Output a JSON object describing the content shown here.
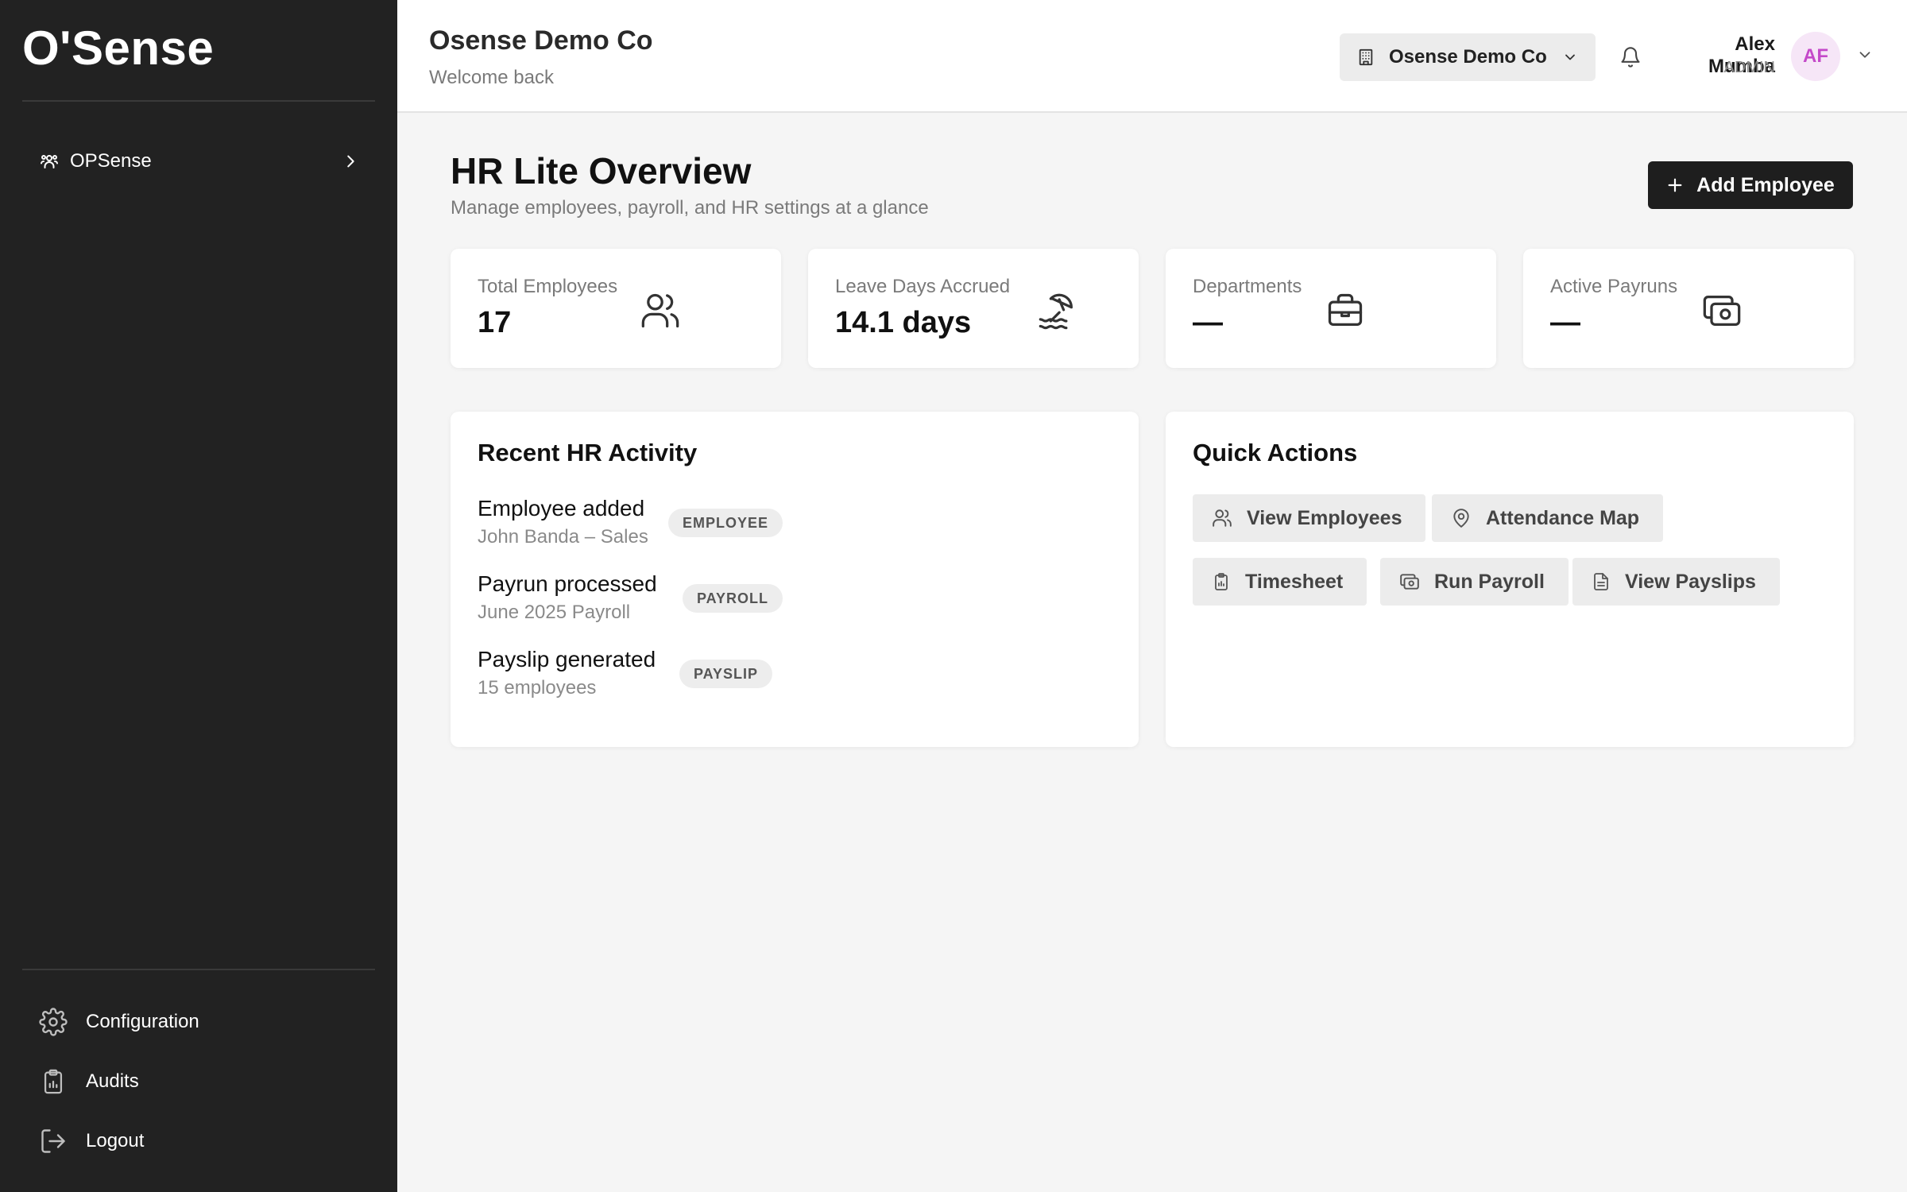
{
  "sidebar": {
    "brand": "O'Sense",
    "nav": [
      {
        "label": "OPSense",
        "icon": "users-icon"
      }
    ],
    "bottom": [
      {
        "label": "Configuration",
        "icon": "gear-icon"
      },
      {
        "label": "Audits",
        "icon": "clipboard-icon"
      },
      {
        "label": "Logout",
        "icon": "logout-icon"
      }
    ]
  },
  "header": {
    "company_name": "Osense Demo Co",
    "welcome": "Welcome back",
    "company_selector": "Osense Demo Co",
    "user": {
      "name": "Alex Mumba",
      "role": "ADMIN",
      "initials": "AF"
    }
  },
  "main": {
    "title": "HR Lite Overview",
    "subtitle": "Manage employees, payroll, and HR settings at a glance",
    "add_button": "Add Employee",
    "stats": [
      {
        "label": "Total Employees",
        "value": "17",
        "icon": "users-icon"
      },
      {
        "label": "Leave Days Accrued",
        "value": "14.1 days",
        "icon": "beach-umbrella-icon"
      },
      {
        "label": "Departments",
        "value": "—",
        "icon": "briefcase-icon"
      },
      {
        "label": "Active Payruns",
        "value": "—",
        "icon": "cash-icon"
      }
    ],
    "activity": {
      "title": "Recent HR Activity",
      "items": [
        {
          "title": "Employee added",
          "subtitle": "John Banda – Sales",
          "badge": "EMPLOYEE"
        },
        {
          "title": "Payrun processed",
          "subtitle": "June 2025 Payroll",
          "badge": "PAYROLL"
        },
        {
          "title": "Payslip generated",
          "subtitle": "15 employees",
          "badge": "PAYSLIP"
        }
      ]
    },
    "quick_actions": {
      "title": "Quick Actions",
      "buttons": [
        {
          "label": "View Employees",
          "icon": "users-icon"
        },
        {
          "label": "Attendance Map",
          "icon": "map-pin-icon"
        },
        {
          "label": "Timesheet",
          "icon": "clipboard-icon"
        },
        {
          "label": "Run Payroll",
          "icon": "cash-icon"
        },
        {
          "label": "View Payslips",
          "icon": "document-icon"
        }
      ]
    }
  },
  "colors": {
    "sidebar_bg": "#222222",
    "primary_button": "#1e1e1e",
    "avatar_bg": "#f6e6f7",
    "avatar_text": "#c449c9",
    "page_bg": "#f5f5f5"
  }
}
